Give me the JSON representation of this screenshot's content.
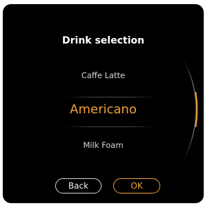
{
  "dialog": {
    "title": "Drink selection"
  },
  "picker": {
    "previous_item": "Caffe Latte",
    "selected_item": "Americano",
    "next_item": "Milk Foam"
  },
  "buttons": {
    "back_label": "Back",
    "ok_label": "OK"
  },
  "colors": {
    "background": "#000000",
    "accent": "#f0a13c",
    "text": "#d8d8d8"
  }
}
